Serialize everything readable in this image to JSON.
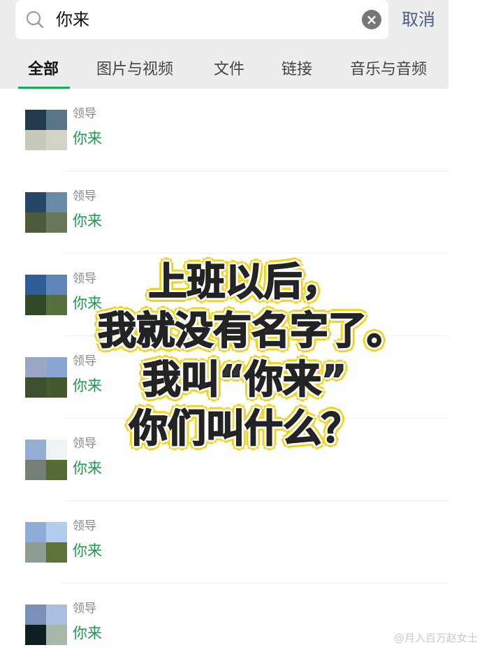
{
  "search": {
    "query": "你来",
    "cancel_label": "取消"
  },
  "tabs": [
    {
      "label": "全部",
      "active": true
    },
    {
      "label": "图片与视频",
      "active": false
    },
    {
      "label": "文件",
      "active": false
    },
    {
      "label": "链接",
      "active": false
    },
    {
      "label": "音乐与音频",
      "active": false
    }
  ],
  "results": [
    {
      "sender": "领导",
      "message": "你来",
      "avatar_colors": [
        "#23394d",
        "#5a7488",
        "#c9c9bb",
        "#d3d3c8"
      ]
    },
    {
      "sender": "领导",
      "message": "你来",
      "avatar_colors": [
        "#27466a",
        "#6b8aa8",
        "#4e5a3c",
        "#687858"
      ]
    },
    {
      "sender": "领导",
      "message": "你来",
      "avatar_colors": [
        "#2d5d94",
        "#5f86b6",
        "#2f4a25",
        "#56703e"
      ]
    },
    {
      "sender": "领导",
      "message": "你来",
      "avatar_colors": [
        "#9aa6c4",
        "#8aa6d6",
        "#3e4f30",
        "#46582e"
      ]
    },
    {
      "sender": "领导",
      "message": "你来",
      "avatar_colors": [
        "#93add4",
        "#eef3f6",
        "#767f76",
        "#566b34"
      ]
    },
    {
      "sender": "领导",
      "message": "你来",
      "avatar_colors": [
        "#8eaed8",
        "#b3cdee",
        "#8e9d94",
        "#5d733a"
      ]
    },
    {
      "sender": "领导",
      "message": "你来",
      "avatar_colors": [
        "#7b90b8",
        "#a9bfe0",
        "#0f1f22",
        "#a8b8a8"
      ]
    }
  ],
  "overlay": {
    "lines": [
      "上班以后，",
      "我就没有名字了。",
      "我叫“你来”",
      "你们叫什么？"
    ]
  },
  "watermark": "@月入百万赵女士",
  "colors": {
    "accent_green": "#1aab5a",
    "message_green": "#1a9c4c",
    "cancel_blue": "#4a5d86",
    "header_bg": "#ededed",
    "overlay_outline": "#f2d21b"
  }
}
